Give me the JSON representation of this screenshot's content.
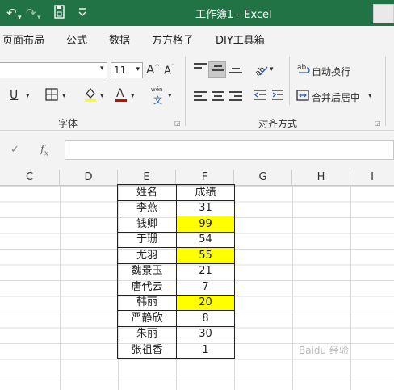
{
  "titlebar": {
    "title": "工作簿1 - Excel",
    "undo_icon": "undo-icon",
    "redo_icon": "redo-icon",
    "save_icon": "save-icon",
    "customize_icon": "customize-icon"
  },
  "menu": {
    "tabs": [
      "页面布局",
      "公式",
      "数据",
      "方方格子",
      "DIY工具箱"
    ]
  },
  "ribbon": {
    "font_size": "11",
    "font_group_label": "字体",
    "align_group_label": "对齐方式",
    "wrap_text": "自动换行",
    "merge_center": "合并后居中",
    "phonetic_top": "wén",
    "phonetic_bottom": "文",
    "bold_underline": "U"
  },
  "formula_bar": {
    "fx": "fx",
    "value": ""
  },
  "sheet": {
    "columns": [
      "C",
      "D",
      "E",
      "F",
      "G",
      "H",
      "I"
    ],
    "highlight_color": "#ffff00",
    "table": {
      "header": [
        "姓名",
        "成绩"
      ],
      "rows": [
        {
          "name": "李燕",
          "score": "31",
          "highlight": false
        },
        {
          "name": "钱卿",
          "score": "99",
          "highlight": true
        },
        {
          "name": "于珊",
          "score": "54",
          "highlight": false
        },
        {
          "name": "尤羽",
          "score": "55",
          "highlight": true
        },
        {
          "name": "魏景玉",
          "score": "21",
          "highlight": false
        },
        {
          "name": "唐代云",
          "score": "7",
          "highlight": false
        },
        {
          "name": "韩丽",
          "score": "20",
          "highlight": true
        },
        {
          "name": "严静欣",
          "score": "8",
          "highlight": false
        },
        {
          "name": "朱丽",
          "score": "30",
          "highlight": false
        },
        {
          "name": "张祖香",
          "score": "1",
          "highlight": false
        }
      ]
    }
  }
}
